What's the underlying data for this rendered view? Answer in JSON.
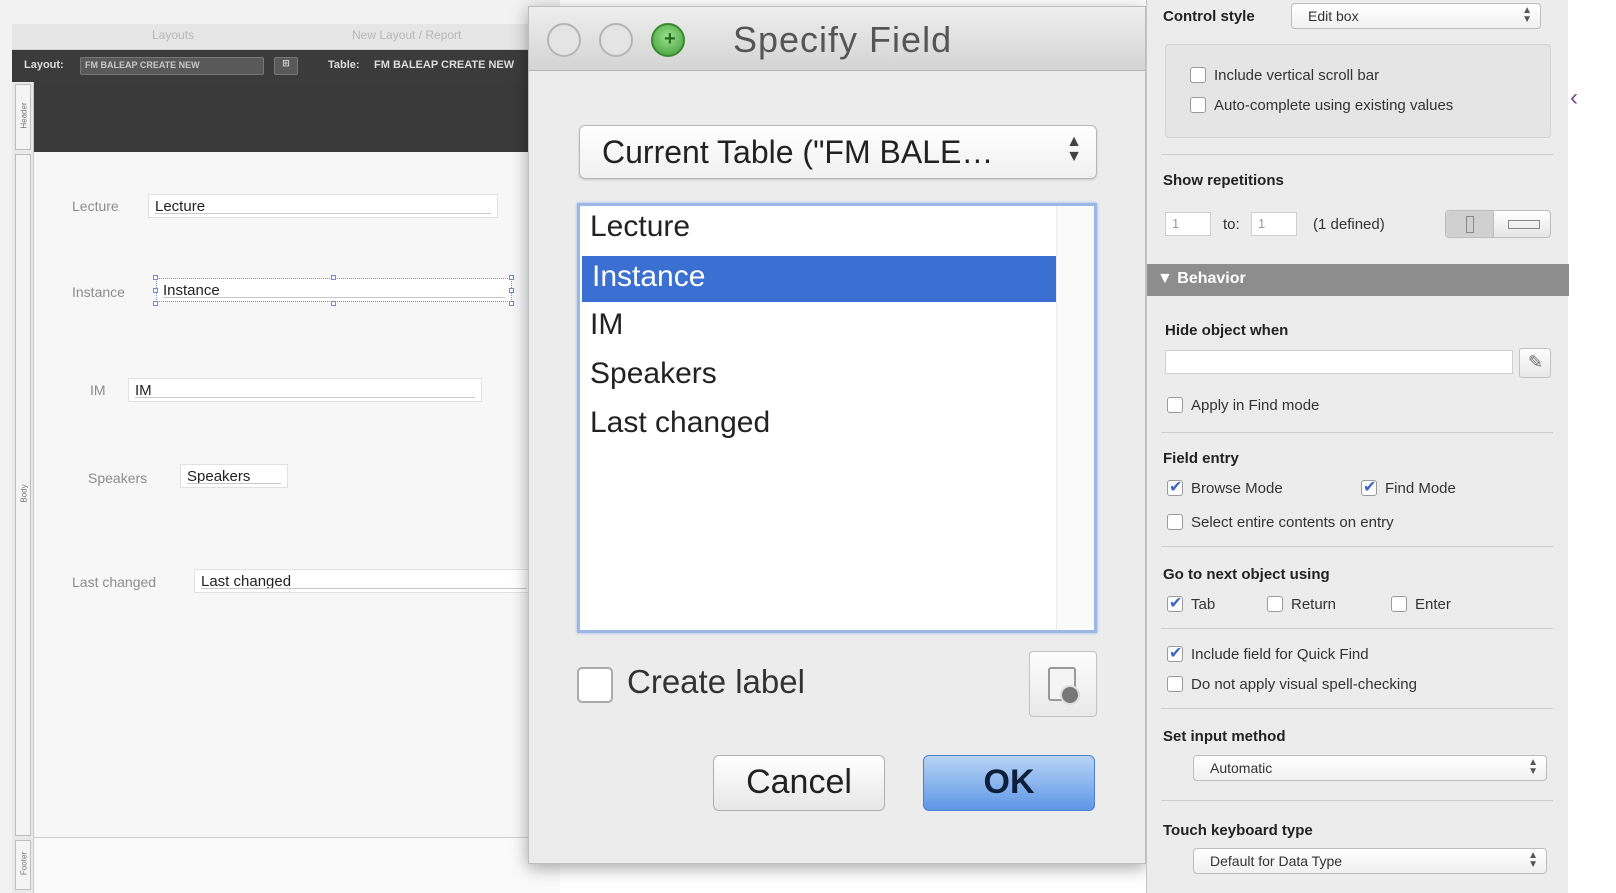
{
  "layout_area": {
    "layouts_bar": {
      "left": "Layouts",
      "right": "New Layout / Report"
    },
    "toolbar": {
      "layout_label": "Layout:",
      "layout_select": "FM BALEAP CREATE NEW",
      "table_label": "Table:",
      "table_value": "FM BALEAP CREATE NEW"
    },
    "part_tabs": {
      "header": "Header",
      "body": "Body",
      "footer": "Footer"
    },
    "fields": [
      {
        "label": "Lecture",
        "value": "Lecture"
      },
      {
        "label": "Instance",
        "value": "Instance"
      },
      {
        "label": "IM",
        "value": "IM"
      },
      {
        "label": "Speakers",
        "value": "Speakers"
      },
      {
        "label": "Last changed",
        "value": "Last changed"
      }
    ]
  },
  "dialog": {
    "title": "Specify Field",
    "table_select": "Current Table (\"FM BALE…",
    "fields": [
      "Lecture",
      "Instance",
      "IM",
      "Speakers",
      "Last changed"
    ],
    "selected_field": "Instance",
    "create_label": "Create label",
    "create_label_checked": false,
    "cancel": "Cancel",
    "ok": "OK"
  },
  "inspector": {
    "control_style_label": "Control style",
    "control_style_value": "Edit box",
    "include_scroll_bar": {
      "label": "Include vertical scroll bar",
      "checked": false
    },
    "auto_complete": {
      "label": "Auto-complete using existing values",
      "checked": false
    },
    "show_repetitions_label": "Show repetitions",
    "rep_from": "1",
    "rep_to_label": "to:",
    "rep_to": "1",
    "rep_defined": "(1 defined)",
    "behavior_header": "▼ Behavior",
    "hide_object_label": "Hide object when",
    "hide_object_value": "",
    "apply_find_mode": {
      "label": "Apply in Find mode",
      "checked": false
    },
    "field_entry_label": "Field entry",
    "browse_mode": {
      "label": "Browse Mode",
      "checked": true
    },
    "find_mode": {
      "label": "Find Mode",
      "checked": true
    },
    "select_entire": {
      "label": "Select entire contents on entry",
      "checked": false
    },
    "go_next_label": "Go to next object using",
    "tab": {
      "label": "Tab",
      "checked": true
    },
    "return": {
      "label": "Return",
      "checked": false
    },
    "enter": {
      "label": "Enter",
      "checked": false
    },
    "quick_find": {
      "label": "Include field for Quick Find",
      "checked": true
    },
    "spell_check": {
      "label": "Do not apply visual spell-checking",
      "checked": false
    },
    "input_method_label": "Set input method",
    "input_method_value": "Automatic",
    "touch_keyboard_label": "Touch keyboard type",
    "touch_keyboard_value": "Default for Data Type"
  },
  "colors": {
    "selection_blue": "#3b70d2",
    "ok_button": "#5d97e6",
    "dark_toolbar": "#3b3b3b",
    "behavior_header": "#8d8d8d"
  }
}
